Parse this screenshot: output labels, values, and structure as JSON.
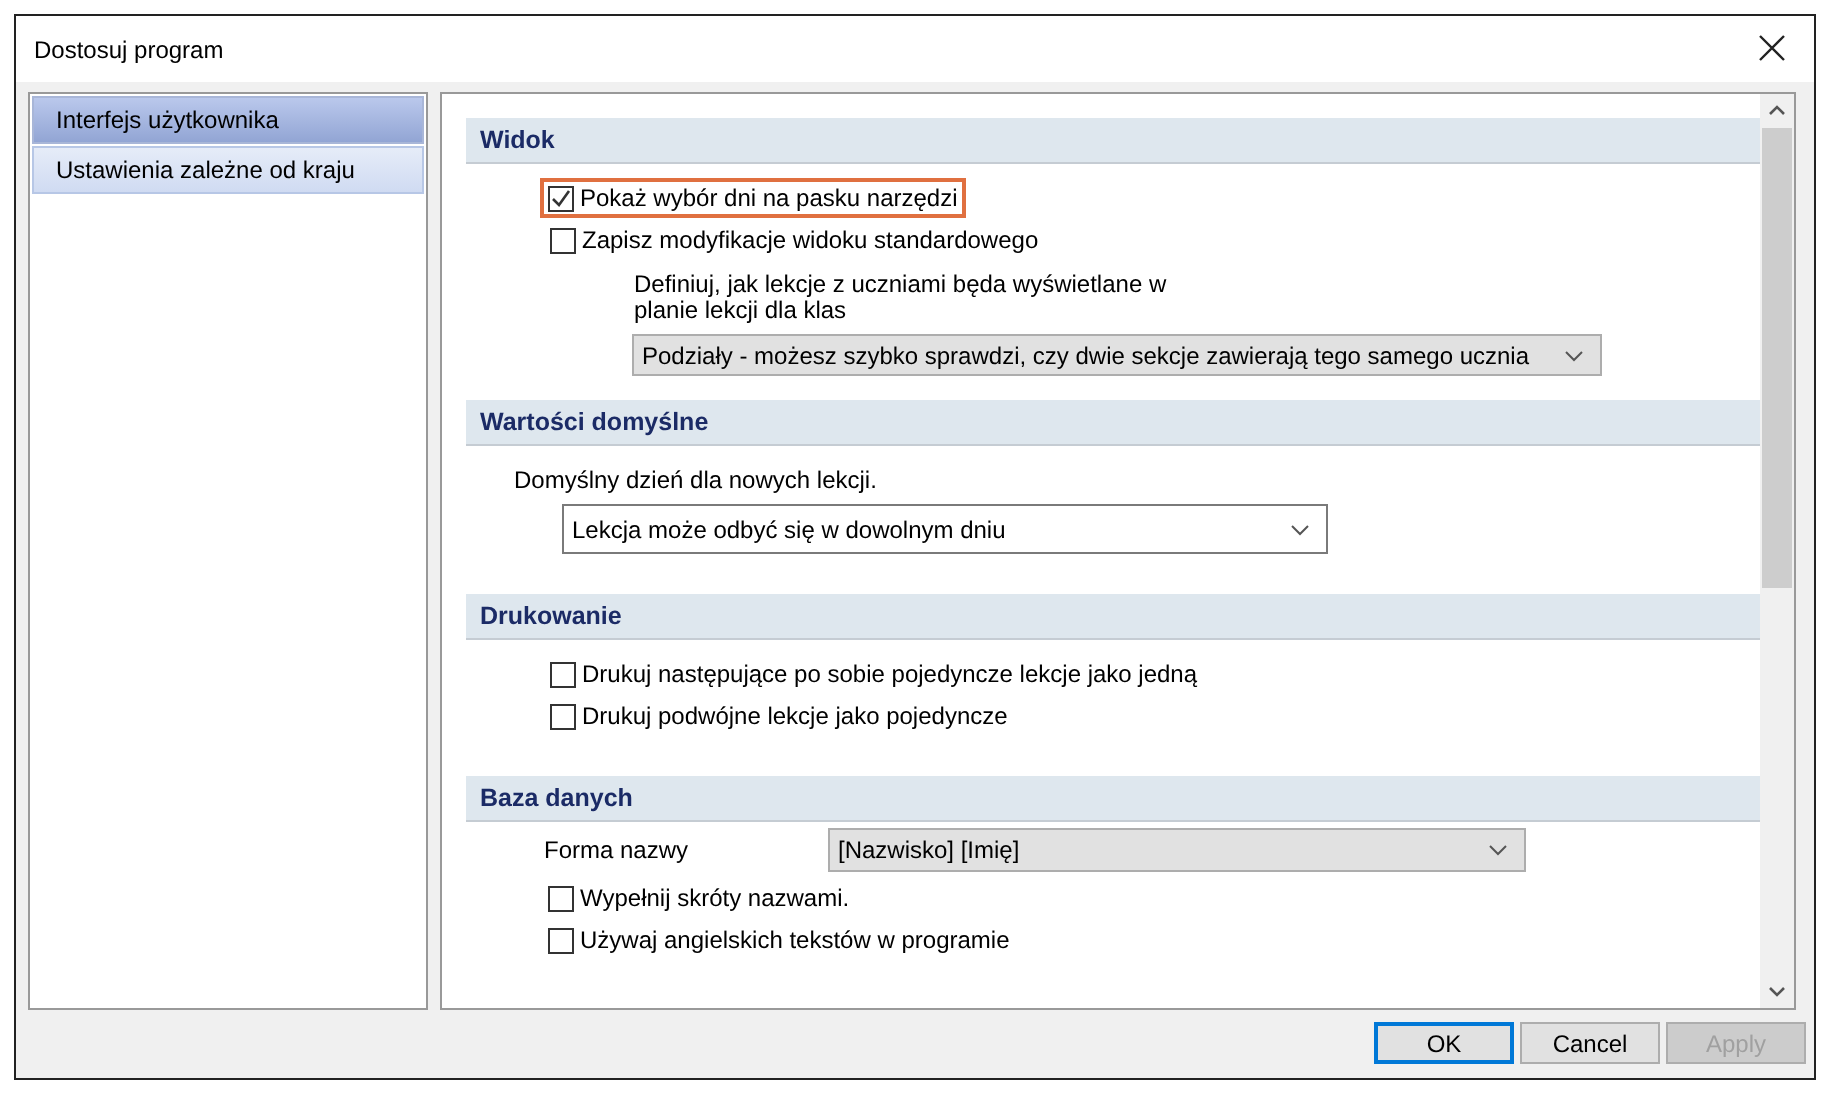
{
  "window": {
    "title": "Dostosuj program"
  },
  "sidebar": {
    "items": [
      {
        "label": "Interfejs użytkownika",
        "selected": true
      },
      {
        "label": "Ustawienia zależne od kraju",
        "selected": false
      }
    ]
  },
  "sections": [
    {
      "title": "Widok",
      "items": [
        {
          "kind": "checkbox",
          "label": "Pokaż wybór dni na pasku narzędzi",
          "checked": true,
          "highlighted": true
        },
        {
          "kind": "checkbox",
          "label": "Zapisz modyfikacje widoku standardowego",
          "checked": false,
          "highlighted": false
        },
        {
          "kind": "text",
          "label": "Definiuj, jak lekcje z uczniami będa wyświetlane w planie lekcji dla klas"
        },
        {
          "kind": "select",
          "value": "Podziały - możesz szybko sprawdzi, czy dwie sekcje zawierają tego samego ucznia",
          "disabled": true
        }
      ]
    },
    {
      "title": "Wartości domyślne",
      "items": [
        {
          "kind": "text",
          "label": "Domyślny dzień dla nowych lekcji."
        },
        {
          "kind": "select",
          "value": "Lekcja może odbyć się w dowolnym dniu",
          "disabled": false
        }
      ]
    },
    {
      "title": "Drukowanie",
      "items": [
        {
          "kind": "checkbox",
          "label": "Drukuj następujące po sobie pojedyncze lekcje jako jedną",
          "checked": false,
          "highlighted": false
        },
        {
          "kind": "checkbox",
          "label": "Drukuj podwójne lekcje jako pojedyncze",
          "checked": false,
          "highlighted": false
        }
      ]
    },
    {
      "title": "Baza danych",
      "items": [
        {
          "kind": "labeled_select",
          "label": "Forma nazwy",
          "value": "[Nazwisko] [Imię]",
          "disabled": true
        },
        {
          "kind": "checkbox",
          "label": "Wypełnij skróty nazwami.",
          "checked": false,
          "highlighted": false
        },
        {
          "kind": "checkbox",
          "label": "Używaj angielskich tekstów w programie",
          "checked": false,
          "highlighted": false
        }
      ]
    }
  ],
  "buttons": [
    {
      "label": "OK",
      "default": true,
      "disabled": false
    },
    {
      "label": "Cancel",
      "default": false,
      "disabled": false
    },
    {
      "label": "Apply",
      "default": false,
      "disabled": true
    }
  ]
}
